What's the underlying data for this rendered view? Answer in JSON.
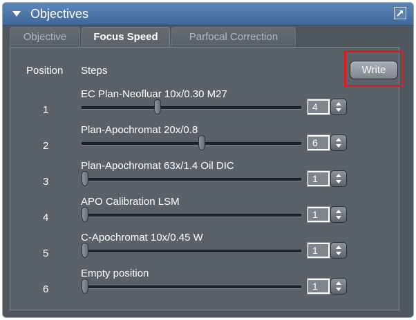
{
  "window": {
    "title": "Objectives",
    "undock_icon": "undock-icon"
  },
  "tabs": [
    {
      "label": "Objective",
      "active": false
    },
    {
      "label": "Focus Speed",
      "active": true
    },
    {
      "label": "Parfocal Correction",
      "active": false
    }
  ],
  "headers": {
    "position": "Position",
    "steps": "Steps"
  },
  "write_label": "Write",
  "highlight_color": "#e01a1a",
  "rows": [
    {
      "position": "1",
      "objective": "EC Plan-Neofluar 10x/0.30 M27",
      "steps": "4",
      "slider_level": 0.34
    },
    {
      "position": "2",
      "objective": "Plan-Apochromat 20x/0.8",
      "steps": "6",
      "slider_level": 0.55
    },
    {
      "position": "3",
      "objective": "Plan-Apochromat 63x/1.4 Oil DIC",
      "steps": "1",
      "slider_level": 0.0
    },
    {
      "position": "4",
      "objective": "APO Calibration LSM",
      "steps": "1",
      "slider_level": 0.0
    },
    {
      "position": "5",
      "objective": "C-Apochromat 10x/0.45 W",
      "steps": "1",
      "slider_level": 0.0
    },
    {
      "position": "6",
      "objective": "Empty position",
      "steps": "1",
      "slider_level": 0.0
    }
  ]
}
